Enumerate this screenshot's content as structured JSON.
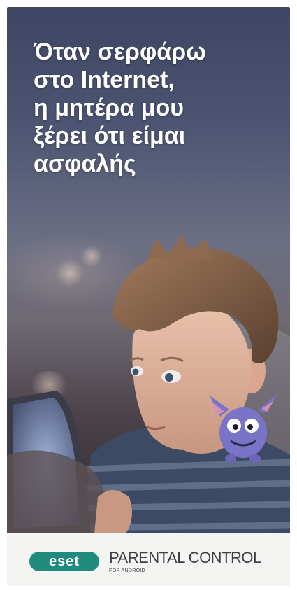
{
  "ad": {
    "headline_lines": [
      "Όταν σερφάρω",
      "στο Internet,",
      "η μητέρα μου",
      "ξέρει ότι είμαι",
      "ασφαλής"
    ],
    "brand": {
      "logo_text": "eset",
      "product_name": "PARENTAL CONTROL",
      "product_subtitle": "FOR ANDROID"
    },
    "colors": {
      "brand_teal": "#1f8a7e",
      "headline": "#ffffff",
      "footer_bg": "#f4f4f2"
    }
  }
}
